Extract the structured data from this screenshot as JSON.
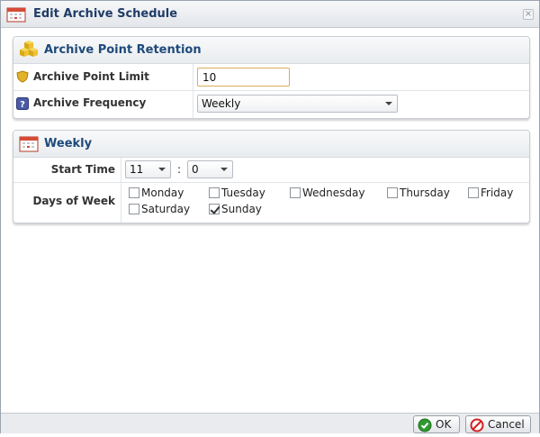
{
  "dialog": {
    "title": "Edit Archive Schedule",
    "close_glyph": "×"
  },
  "retention": {
    "title": "Archive Point Retention",
    "limit_label": "Archive Point Limit",
    "limit_value": "10",
    "frequency_label": "Archive Frequency",
    "frequency_value": "Weekly"
  },
  "weekly": {
    "title": "Weekly",
    "start_time_label": "Start Time",
    "hour": "11",
    "separator": ":",
    "minute": "0",
    "days_label": "Days of Week",
    "days": [
      {
        "label": "Monday",
        "checked": false
      },
      {
        "label": "Tuesday",
        "checked": false
      },
      {
        "label": "Wednesday",
        "checked": false
      },
      {
        "label": "Thursday",
        "checked": false
      },
      {
        "label": "Friday",
        "checked": false
      },
      {
        "label": "Saturday",
        "checked": false
      },
      {
        "label": "Sunday",
        "checked": true
      }
    ]
  },
  "footer": {
    "ok_label": "OK",
    "cancel_label": "Cancel"
  },
  "icons": {
    "title": "calendar-icon",
    "retention": "stacked-boxes-icon",
    "limit": "shield-icon",
    "frequency": "question-icon",
    "weekly": "calendar-icon",
    "ok": "check-circle-icon",
    "cancel": "no-entry-icon"
  },
  "colors": {
    "accent": "#1e4a7a",
    "input_border": "#d8ac5a",
    "ok_green": "#2e9a2e",
    "cancel_red": "#d32020"
  }
}
